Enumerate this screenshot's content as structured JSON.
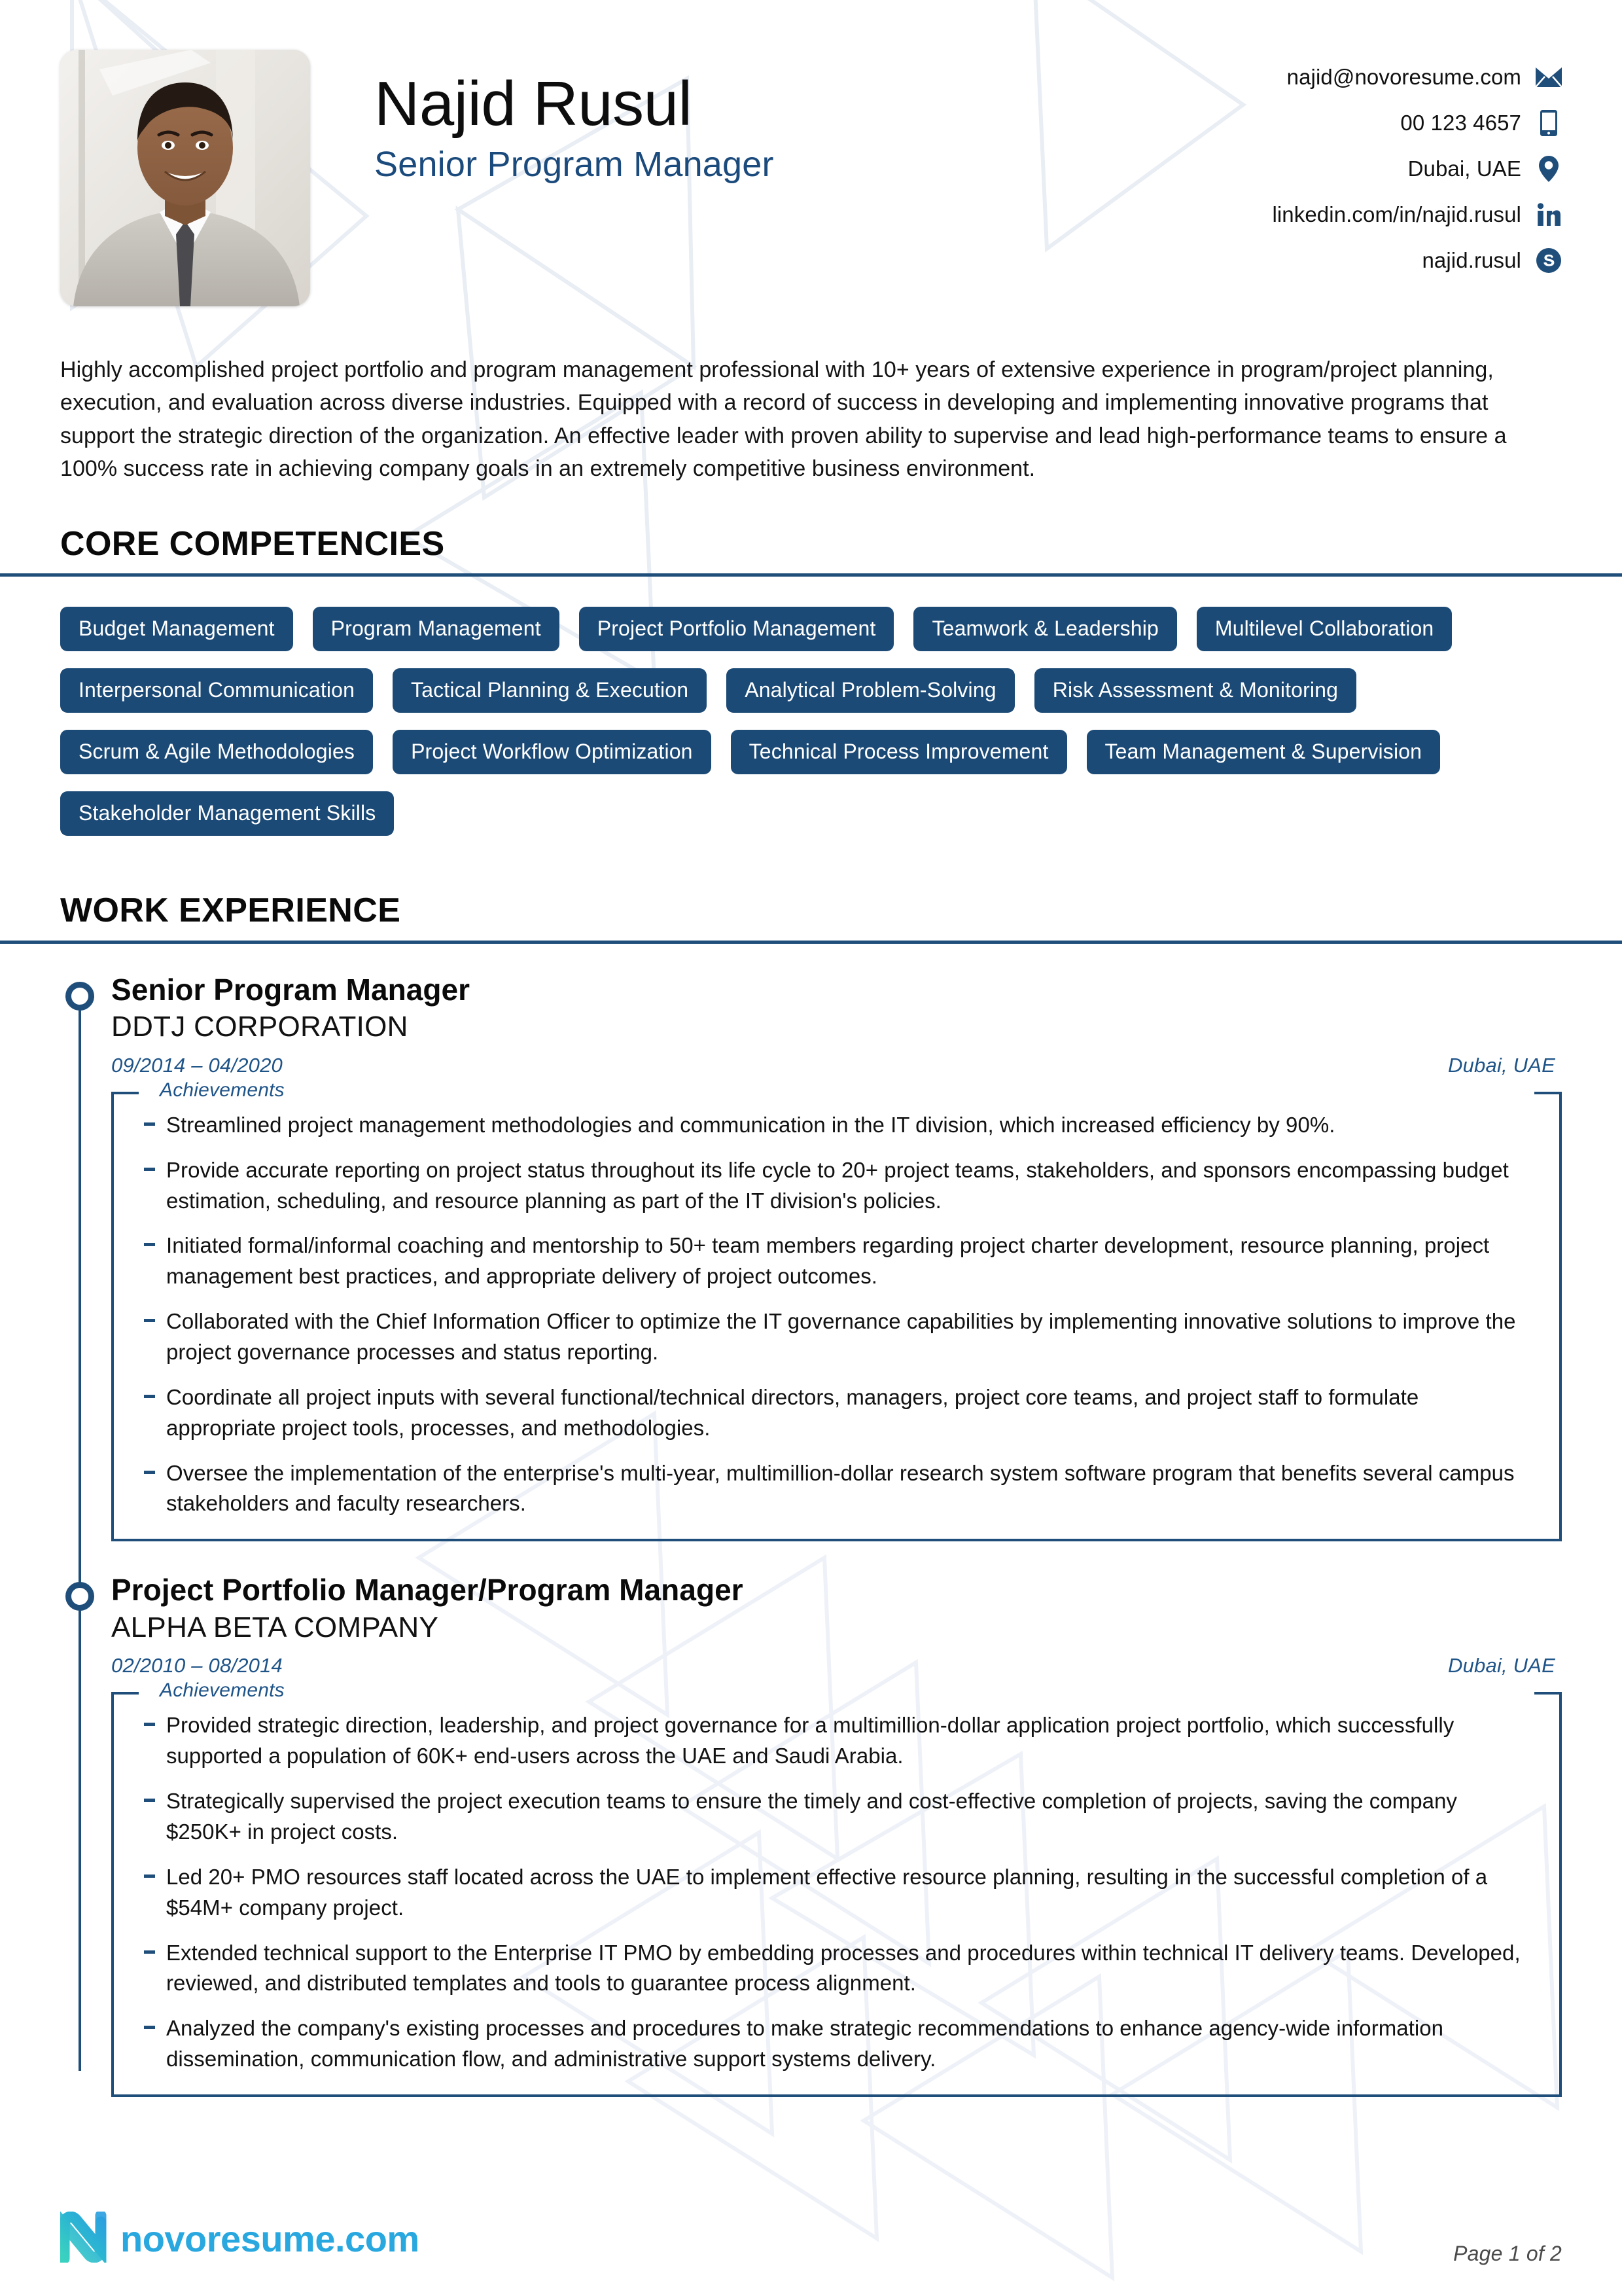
{
  "header": {
    "name": "Najid Rusul",
    "job_title": "Senior Program Manager",
    "photo_alt": "profile-photo",
    "contacts": [
      {
        "icon": "envelope-icon",
        "text": "najid@novoresume.com"
      },
      {
        "icon": "smartphone-icon",
        "text": "00 123 4657"
      },
      {
        "icon": "location-pin-icon",
        "text": "Dubai, UAE"
      },
      {
        "icon": "linkedin-icon",
        "text": "linkedin.com/in/najid.rusul"
      },
      {
        "icon": "skype-icon",
        "text": "najid.rusul"
      }
    ]
  },
  "summary": "Highly accomplished project portfolio and program management professional with 10+ years of extensive experience in program/project planning, execution, and evaluation across diverse industries. Equipped with a record of success in developing and implementing innovative programs that support the strategic direction of the organization. An effective leader with proven ability to supervise and lead high-performance teams to ensure a 100% success rate in achieving company goals in an extremely competitive business environment.",
  "core_competencies": {
    "title": "CORE COMPETENCIES",
    "tags": [
      "Budget Management",
      "Program Management",
      "Project Portfolio Management",
      "Teamwork & Leadership",
      "Multilevel Collaboration",
      "Interpersonal Communication",
      "Tactical Planning & Execution",
      "Analytical Problem-Solving",
      "Risk Assessment & Monitoring",
      "Scrum & Agile Methodologies",
      "Project Workflow Optimization",
      "Technical Process Improvement",
      "Team Management & Supervision",
      "Stakeholder Management Skills"
    ]
  },
  "work_experience": {
    "title": "WORK EXPERIENCE",
    "achievements_label": "Achievements",
    "jobs": [
      {
        "title": "Senior Program Manager",
        "company": "DDTJ CORPORATION",
        "dates": "09/2014 – 04/2020",
        "location": "Dubai, UAE",
        "bullets": [
          "Streamlined project management methodologies and communication in the IT division, which increased efficiency by 90%.",
          "Provide accurate reporting on project status throughout its life cycle to 20+ project teams, stakeholders, and sponsors encompassing budget estimation, scheduling, and resource planning as part of the IT division's policies.",
          "Initiated formal/informal coaching and mentorship to 50+ team members regarding project charter development, resource planning, project management best practices, and appropriate delivery of project outcomes.",
          "Collaborated with the Chief Information Officer to optimize the IT governance capabilities by implementing innovative solutions to improve the project governance processes and status reporting.",
          "Coordinate all project inputs with several functional/technical directors, managers, project core teams, and project staff to formulate appropriate project tools, processes, and methodologies.",
          "Oversee the implementation of the enterprise's multi-year, multimillion-dollar research system software program that benefits several campus stakeholders and faculty researchers."
        ]
      },
      {
        "title": "Project Portfolio Manager/Program Manager",
        "company": "ALPHA BETA COMPANY",
        "dates": "02/2010 – 08/2014",
        "location": "Dubai, UAE",
        "bullets": [
          "Provided strategic direction, leadership, and project governance for a multimillion-dollar application project portfolio, which successfully supported a population of 60K+ end-users across the UAE and Saudi Arabia.",
          "Strategically supervised the project execution teams to ensure the timely and cost-effective completion of projects, saving the company $250K+ in project costs.",
          "Led 20+ PMO resources staff located across the UAE to implement effective resource planning, resulting in the successful completion of a $54M+ company project.",
          "Extended technical support to the Enterprise IT PMO by embedding processes and procedures within technical IT delivery teams. Developed, reviewed, and distributed templates and tools to guarantee process alignment.",
          "Analyzed the company's existing processes and procedures to make strategic recommendations to enhance agency-wide information dissemination, communication flow, and administrative support systems delivery."
        ]
      }
    ]
  },
  "footer": {
    "logo_text": "novoresume.com",
    "logo_mark": "novoresume-n-icon",
    "page_number": "Page 1 of 2"
  },
  "colors": {
    "accent_blue": "#1f4e7a",
    "tag_blue": "#1c4a76",
    "title_blue": "#1b4a7c",
    "meta_blue": "#1f5488",
    "logo_blue": "#29a8e0",
    "logo_teal": "#3ad1c0"
  }
}
